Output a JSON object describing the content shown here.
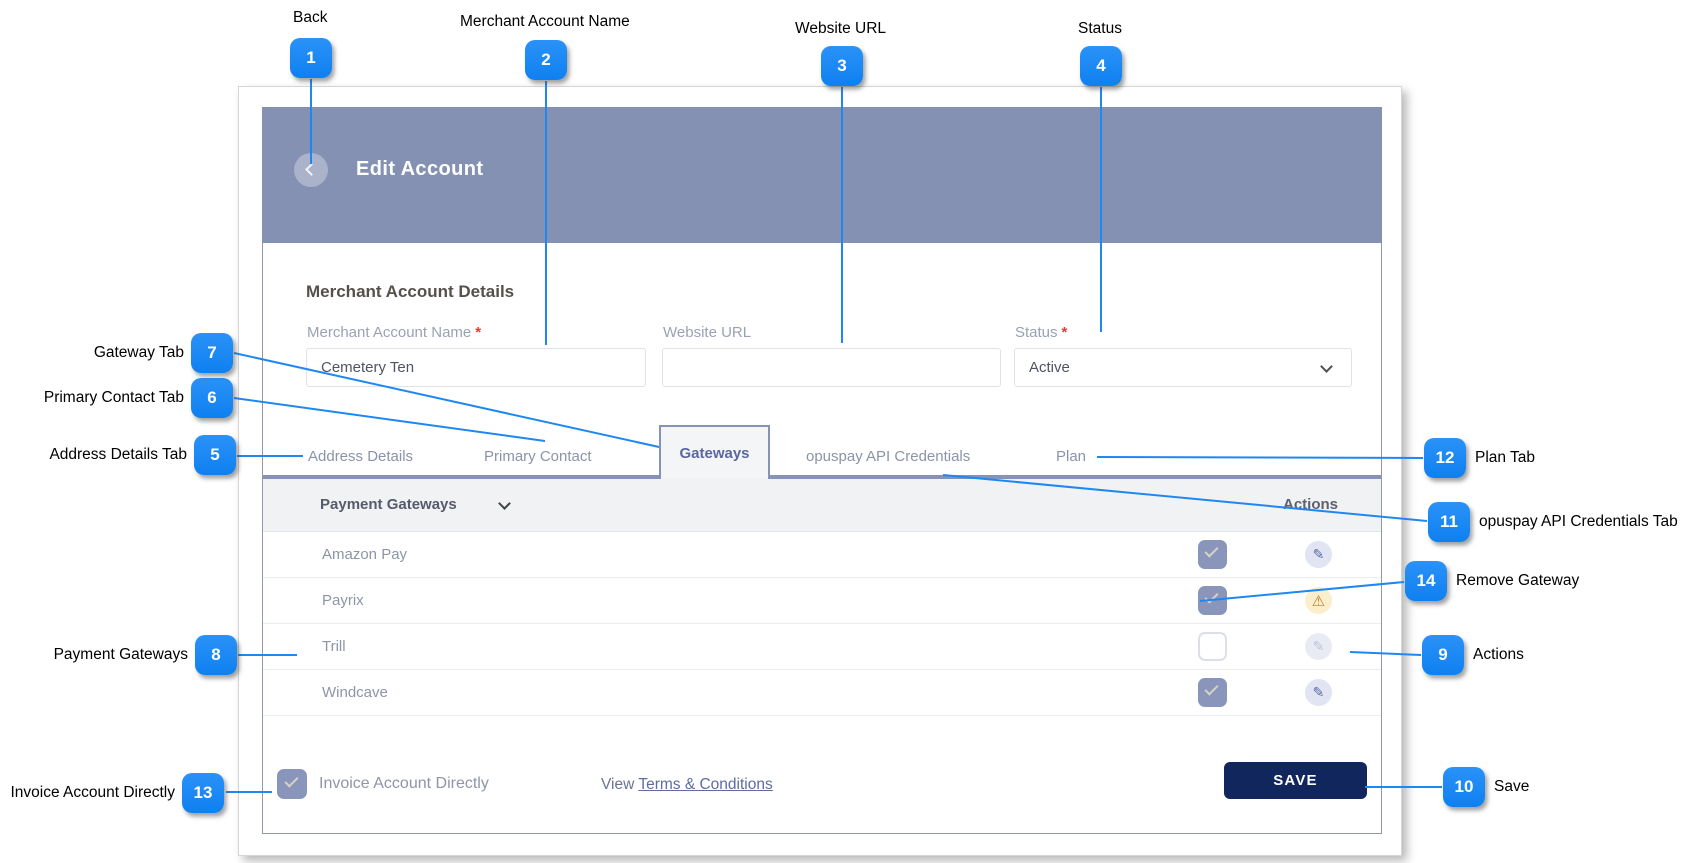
{
  "header": {
    "title": "Edit Account"
  },
  "form": {
    "section_title": "Merchant Account Details",
    "fields": [
      {
        "label": "Merchant Account Name",
        "required": "*",
        "value": "Cemetery Ten"
      },
      {
        "label": "Website URL",
        "required": "",
        "value": ""
      },
      {
        "label": "Status",
        "required": "*",
        "value": "Active",
        "type": "select"
      }
    ]
  },
  "tabs": [
    {
      "label": "Address Details",
      "active": false
    },
    {
      "label": "Primary Contact",
      "active": false
    },
    {
      "label": "Gateways",
      "active": true
    },
    {
      "label": "opuspay API Credentials",
      "active": false
    },
    {
      "label": "Plan",
      "active": false
    }
  ],
  "table": {
    "header": "Payment Gateways",
    "actions_header": "Actions",
    "rows": [
      {
        "name": "Amazon Pay",
        "checked": true,
        "action": "edit"
      },
      {
        "name": "Payrix",
        "checked": true,
        "action": "warning"
      },
      {
        "name": "Trill",
        "checked": false,
        "action": "edit-disabled"
      },
      {
        "name": "Windcave",
        "checked": true,
        "action": "edit"
      }
    ]
  },
  "footer": {
    "checkbox_label": "Invoice Account Directly",
    "checkbox_checked": true,
    "view_text": "View ",
    "terms_link": "Terms & Conditions",
    "save_label": "SAVE"
  },
  "icons": {
    "edit": "✎",
    "warning": "⚠"
  },
  "colors": {
    "header_bar": "#8491b3",
    "callout_badge": "#1587f5",
    "callout_line": "#1e87f2",
    "save_button": "#12265e",
    "checkbox_checked": "#8995ba",
    "warning_icon": "#bd7a2d",
    "active_tab_text": "#5a67a0",
    "required_asterisk": "#e03c31"
  },
  "callouts": {
    "items": [
      {
        "num": "1",
        "label": "Back"
      },
      {
        "num": "2",
        "label": "Merchant Account Name"
      },
      {
        "num": "3",
        "label": "Website URL"
      },
      {
        "num": "4",
        "label": "Status"
      },
      {
        "num": "5",
        "label": "Address Details Tab"
      },
      {
        "num": "6",
        "label": "Primary Contact Tab"
      },
      {
        "num": "7",
        "label": "Gateway Tab"
      },
      {
        "num": "8",
        "label": "Payment Gateways"
      },
      {
        "num": "9",
        "label": "Actions"
      },
      {
        "num": "10",
        "label": "Save"
      },
      {
        "num": "11",
        "label": "opuspay API Credentials Tab"
      },
      {
        "num": "12",
        "label": "Plan Tab"
      },
      {
        "num": "13",
        "label": "Invoice Account Directly"
      },
      {
        "num": "14",
        "label": "Remove Gateway"
      }
    ]
  }
}
